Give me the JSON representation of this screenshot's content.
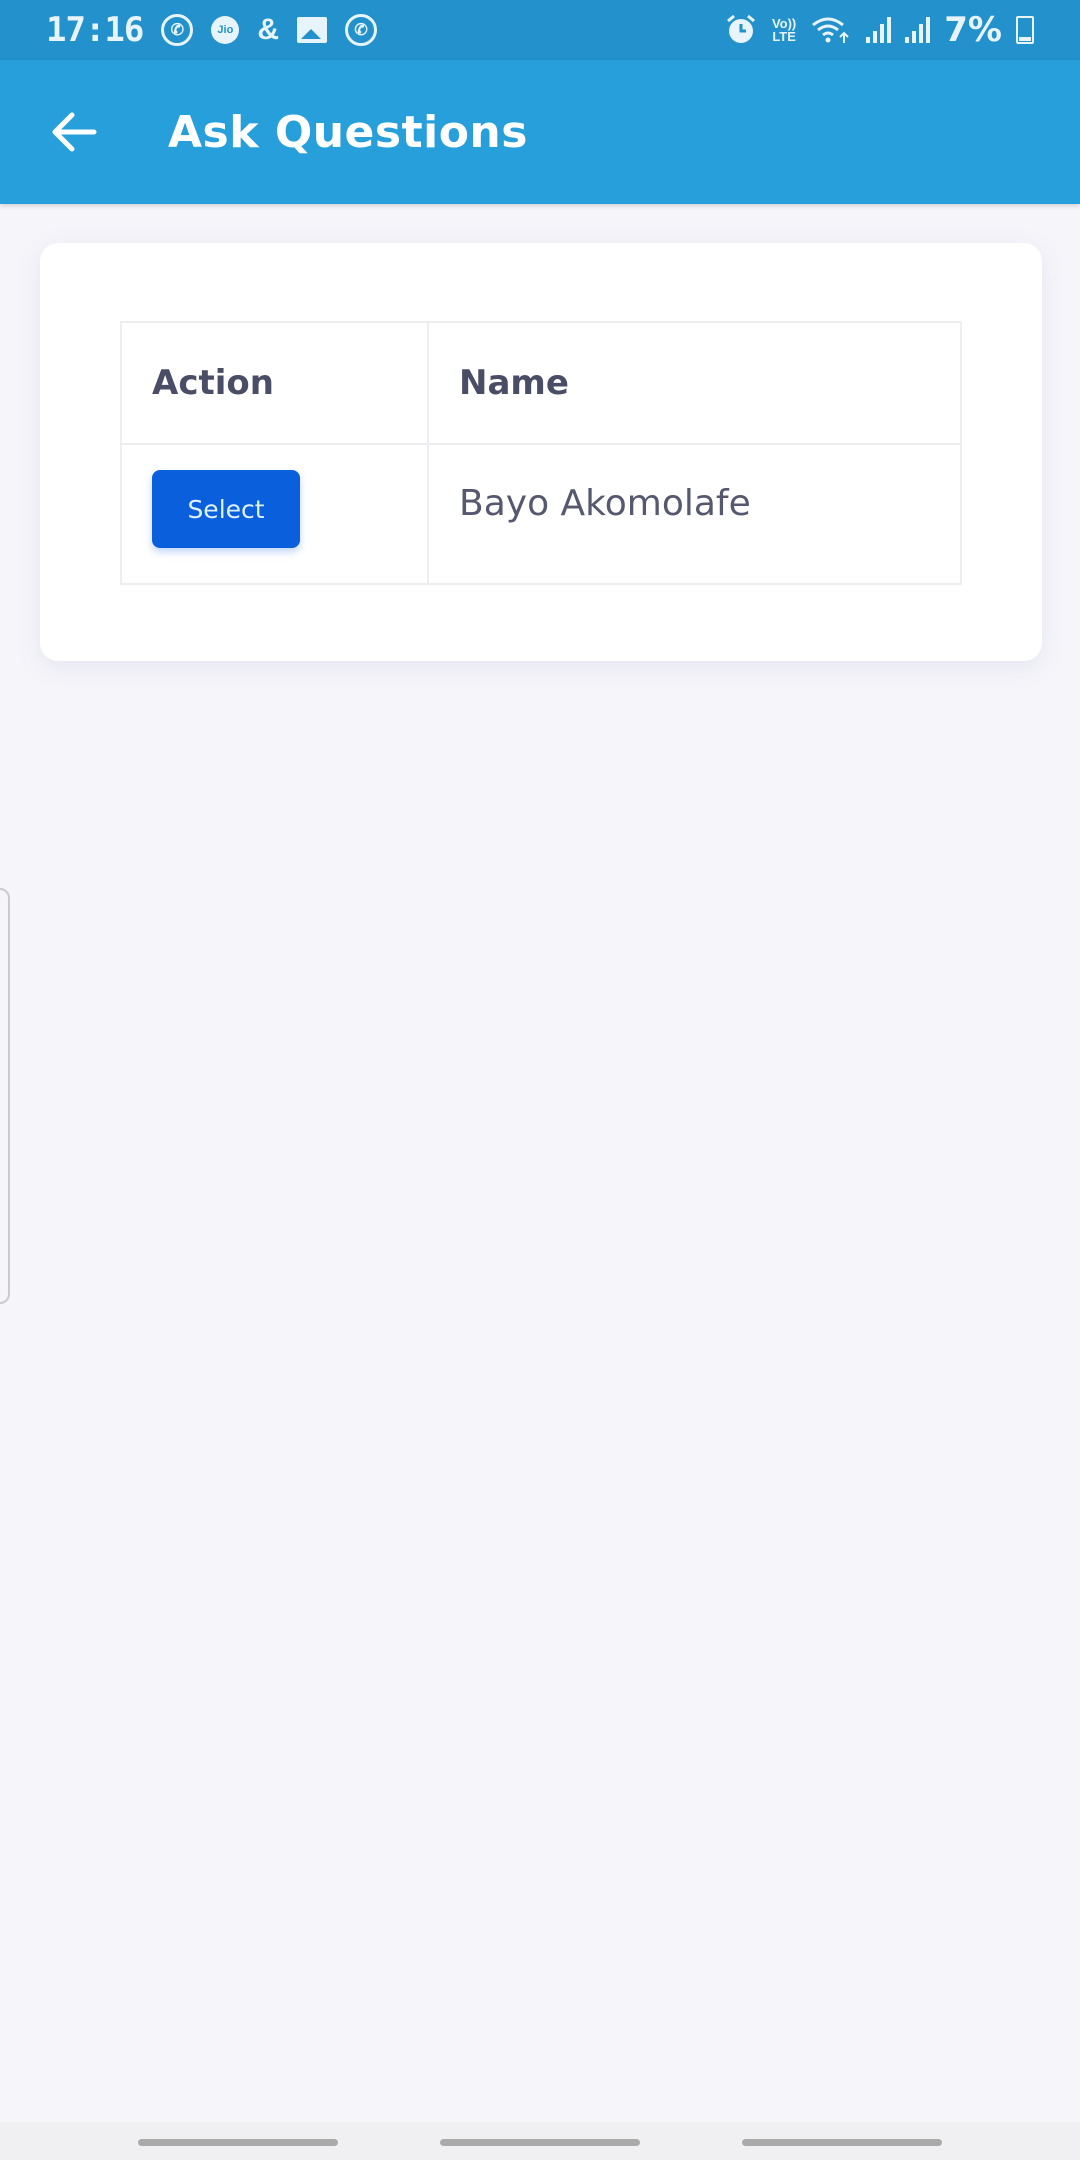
{
  "status_bar": {
    "time": "17:16",
    "left_icons": [
      "whatsapp-icon",
      "jio-icon",
      "notification-icon",
      "gallery-icon",
      "call-icon"
    ],
    "jio_label": "Jio",
    "volte_label_top": "Vo))",
    "volte_label_bottom": "LTE",
    "battery_percent": "7%",
    "right_icons": [
      "alarm-icon",
      "volte-icon",
      "wifi-icon",
      "signal-icon",
      "signal-icon",
      "battery-charging-icon"
    ]
  },
  "app_bar": {
    "title": "Ask Questions",
    "back_icon": "arrow-left-icon",
    "background_color": "#279fdb"
  },
  "table": {
    "columns": [
      "Action",
      "Name"
    ],
    "rows": [
      {
        "action_label": "Select",
        "name": "Bayo Akomolafe"
      }
    ],
    "button_color": "#0a5fdc"
  },
  "nav_bar": {
    "buttons": [
      "recents",
      "home",
      "back"
    ]
  }
}
